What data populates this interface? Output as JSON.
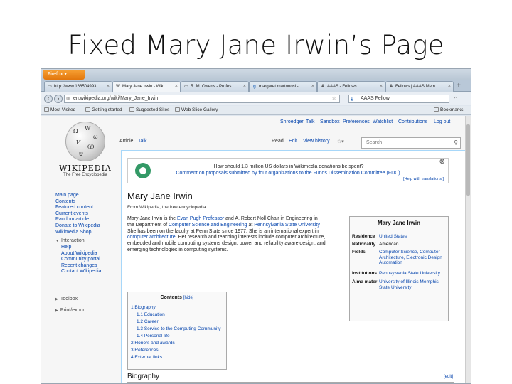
{
  "slide": {
    "title": "Fixed Mary Jane Irwin’s Page"
  },
  "browser": {
    "firefox_button": "Firefox",
    "tabs": [
      {
        "label": "http://www.166504993",
        "icon": "page-icon",
        "active": false
      },
      {
        "label": "Mary Jane Irwin - Wiki...",
        "icon": "wikipedia-icon",
        "active": true
      },
      {
        "label": "R. M. Owens - Profes...",
        "icon": "page-icon",
        "active": false
      },
      {
        "label": "margaret martonosi -...",
        "icon": "google-icon",
        "active": false
      },
      {
        "label": "AAAS - Fellows",
        "icon": "aaas-icon",
        "active": false
      },
      {
        "label": "Fellows | AAAS Mem...",
        "icon": "aaas-icon",
        "active": false
      }
    ],
    "url": "en.wikipedia.org/wiki/Mary_Jane_Irwin",
    "search_value": "AAAS Fellow",
    "bookmarks": [
      "Most Visited",
      "Getting started",
      "Suggested Sites",
      "Web Slice Gallery"
    ],
    "bookmarks_menu": "Bookmarks"
  },
  "wiki": {
    "personal": [
      "Shroedger",
      "Talk",
      "Sandbox",
      "Preferences",
      "Watchlist",
      "Contributions",
      "Log out"
    ],
    "wordmark": "WIKIPEDIA",
    "tagline": "The Free Encyclopedia",
    "nav": [
      "Main page",
      "Contents",
      "Featured content",
      "Current events",
      "Random article",
      "Donate to Wikipedia",
      "Wikimedia Shop"
    ],
    "interaction_head": "Interaction",
    "interaction": [
      "Help",
      "About Wikipedia",
      "Community portal",
      "Recent changes",
      "Contact Wikipedia"
    ],
    "toolbox": "Toolbox",
    "printexport": "Print/export",
    "tabs": {
      "article": "Article",
      "talk": "Talk",
      "read": "Read",
      "edit": "Edit",
      "history": "View history"
    },
    "search_placeholder": "Search",
    "banner": {
      "line1": "How should 1.3 million US dollars in Wikimedia donations be spent?",
      "line2": "Comment on proposals submitted by four organizations to the Funds Dissemination Committee (FDC).",
      "help": "[Help with translations!]"
    },
    "title": "Mary Jane Irwin",
    "from": "From Wikipedia, the free encyclopedia",
    "para": {
      "l1a": "Mary Jane Irwin is the ",
      "l1b": "Evan Pugh Professor",
      "l1c": " and A. Robert Noll Chair in Engineering in",
      "l2a": "the Department of ",
      "l2b": "Computer Science and Engineering",
      "l2c": " at ",
      "l2d": "Pennsylvania State University",
      "l3": "She has been on the faculty at Penn State since 1977. She is an international expert in",
      "l4a": "computer architecture",
      "l4b": ". Her research and teaching interests include computer architecture,",
      "l5": "embedded and mobile computing systems design, power and reliability aware design, and",
      "l6": "emerging technologies in computing systems."
    },
    "infobox": {
      "title": "Mary Jane Irwin",
      "residence_k": "Residence",
      "residence_v": "United States",
      "nationality_k": "Nationality",
      "nationality_v": "American",
      "fields_k": "Fields",
      "fields_v": "Computer Science, Computer Architecture, Electronic Design Automation",
      "institutions_k": "Institutions",
      "institutions_v": "Pennsylvania State University",
      "alma_k": "Alma mater",
      "alma_v": "University of Illinois Memphis State University"
    },
    "toc": {
      "title": "Contents",
      "hide": "[hide]",
      "items": [
        "1 Biography",
        "1.1 Education",
        "1.2 Career",
        "1.3 Service to the Computing Community",
        "1.4 Personal life",
        "2 Honors and awards",
        "3 References",
        "4 External links"
      ]
    },
    "section": {
      "title": "Biography",
      "edit": "[edit]"
    }
  }
}
